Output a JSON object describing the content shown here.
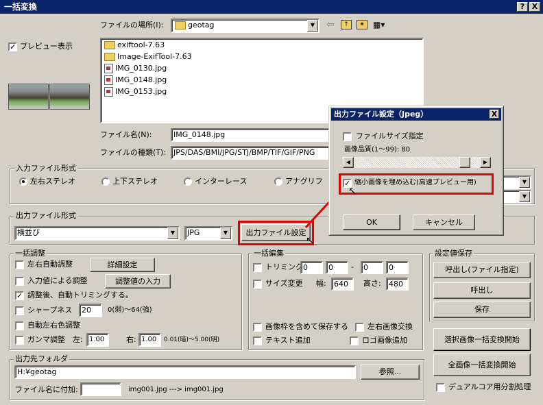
{
  "window": {
    "title": "一括変換",
    "help_btn": "?",
    "close_btn": "X"
  },
  "location": {
    "label": "ファイルの場所(I):",
    "value": "geotag"
  },
  "preview": {
    "label": "プレビュー表示",
    "checked": true
  },
  "files": [
    "exiftool-7.63",
    "Image-ExifTool-7.63",
    "IMG_0130.jpg",
    "IMG_0148.jpg",
    "IMG_0153.jpg"
  ],
  "filename": {
    "label": "ファイル名(N):",
    "value": "IMG_0148.jpg"
  },
  "filetype": {
    "label": "ファイルの種類(T):",
    "value": "JPS/DAS/BMI/JPG/STJ/BMP/TIF/GIF/PNG"
  },
  "input_format": {
    "title": "入力ファイル形式",
    "options": [
      "左右ステレオ",
      "上下ステレオ",
      "インターレース",
      "アナグリフ"
    ]
  },
  "output_format": {
    "title": "出力ファイル形式",
    "layout": "横並び",
    "type": "JPG",
    "settings_btn": "出力ファイル設定"
  },
  "bulk_adjust": {
    "title": "一括調整",
    "auto_lr": "左右自動調整",
    "detail_btn": "詳細設定",
    "by_input": "入力値による調整",
    "input_btn": "調整値の入力",
    "auto_trim": "調整後、自動トリミングする。",
    "sharpness": "シャープネス",
    "sharpness_val": "20",
    "sharpness_range": "0(弱)～64(強)",
    "auto_color": "自動左右色調整",
    "gamma": "ガンマ調整",
    "gamma_left_lbl": "左:",
    "gamma_left": "1.00",
    "gamma_right_lbl": "右:",
    "gamma_right": "1.00",
    "gamma_range": "0.01(暗)～5.00(明)"
  },
  "bulk_edit": {
    "title": "一括編集",
    "trim": "トリミング",
    "trim_vals": [
      "0",
      "0",
      "0",
      "0"
    ],
    "trim_dash": "-",
    "resize": "サイズ変更",
    "width_lbl": "幅:",
    "width": "640",
    "height_lbl": "高さ:",
    "height": "480",
    "save_frame": "画像枠を含めて保存する",
    "swap": "左右画像交換",
    "add_text": "テキスト追加",
    "add_logo": "ロゴ画像追加"
  },
  "presets": {
    "title": "設定値保存",
    "load_file": "呼出し(ファイル指定)",
    "load": "呼出し",
    "save": "保存"
  },
  "actions": {
    "convert_selected": "選択画像一括変換開始",
    "convert_all": "全画像一括変換開始",
    "dual_core": "デュアルコア用分割処理"
  },
  "output_folder": {
    "title": "出力先フォルダ",
    "path": "H:¥geotag",
    "browse_btn": "参照...",
    "suffix_lbl": "ファイル名に付加:",
    "suffix_val": "",
    "example": "img001.jpg ---> img001.jpg"
  },
  "dialog": {
    "title": "出力ファイル設定（Jpeg）",
    "close": "X",
    "size_spec": "ファイルサイズ指定",
    "quality_lbl": "画像品質(1～99): 80",
    "quality": 80,
    "embed_thumb": "縮小画像を埋め込む(高速プレビュー用)",
    "ok": "OK",
    "cancel": "キャンセル"
  },
  "colors": {
    "accent": "#0a246a",
    "highlight": "#e00000"
  }
}
